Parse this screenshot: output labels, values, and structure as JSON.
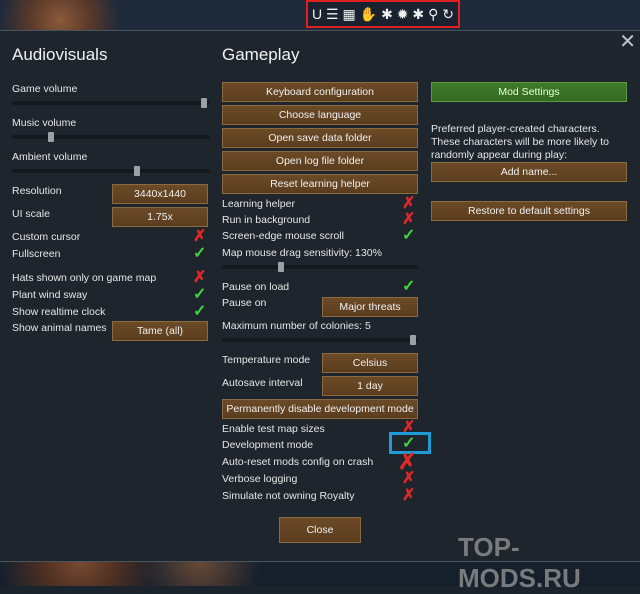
{
  "toolbar": {
    "icons": [
      "u-icon",
      "list-icon",
      "grid-icon",
      "hand-icon",
      "puzzle-icon",
      "gear-icon",
      "puzzle2-icon",
      "search-icon",
      "refresh-icon"
    ],
    "glyphs": [
      "U",
      "☰",
      "▦",
      "✋",
      "✱",
      "✹",
      "✱",
      "⚲",
      "↻"
    ]
  },
  "audiovisuals": {
    "title": "Audiovisuals",
    "game_volume": "Game volume",
    "music_volume": "Music volume",
    "ambient_volume": "Ambient volume",
    "resolution": {
      "label": "Resolution",
      "value": "3440x1440"
    },
    "ui_scale": {
      "label": "UI scale",
      "value": "1.75x"
    },
    "custom_cursor": "Custom cursor",
    "fullscreen": "Fullscreen",
    "hats": "Hats shown only on game map",
    "plant_sway": "Plant wind sway",
    "realtime_clock": "Show realtime clock",
    "animal_names": {
      "label": "Show animal names",
      "value": "Tame (all)"
    },
    "sliders": {
      "game": 0.97,
      "music": 0.2,
      "ambient": 0.6
    }
  },
  "gameplay": {
    "title": "Gameplay",
    "buttons": [
      "Keyboard configuration",
      "Choose language",
      "Open save data folder",
      "Open log file folder",
      "Reset learning helper"
    ],
    "learning_helper": "Learning helper",
    "run_background": "Run in background",
    "edge_scroll": "Screen-edge mouse scroll",
    "drag_sensitivity": "Map mouse drag sensitivity: 130%",
    "pause_on_load": "Pause on load",
    "pause_on": {
      "label": "Pause on",
      "value": "Major threats"
    },
    "max_colonies": "Maximum number of colonies: 5",
    "temp_mode": {
      "label": "Temperature mode",
      "value": "Celsius"
    },
    "autosave": {
      "label": "Autosave interval",
      "value": "1 day"
    },
    "disable_dev": "Permanently disable development mode",
    "test_maps": "Enable test map sizes",
    "dev_mode": "Development mode",
    "auto_reset": "Auto-reset mods config on crash",
    "verbose": "Verbose logging",
    "simulate_royalty": "Simulate not owning Royalty",
    "close": "Close",
    "sliders": {
      "drag": 0.3,
      "colonies": 0.98
    }
  },
  "right": {
    "mod_settings": "Mod Settings",
    "preferred_text": "Preferred player-created characters. These characters will be more likely to randomly appear during play:",
    "add_name": "Add name...",
    "restore": "Restore to default settings"
  },
  "watermark": "TOP-MODS.RU",
  "colors": {
    "accent_green": "#3fd43f",
    "accent_red": "#e02828",
    "highlight": "#1e9ad6",
    "button": "#6b4a26"
  }
}
